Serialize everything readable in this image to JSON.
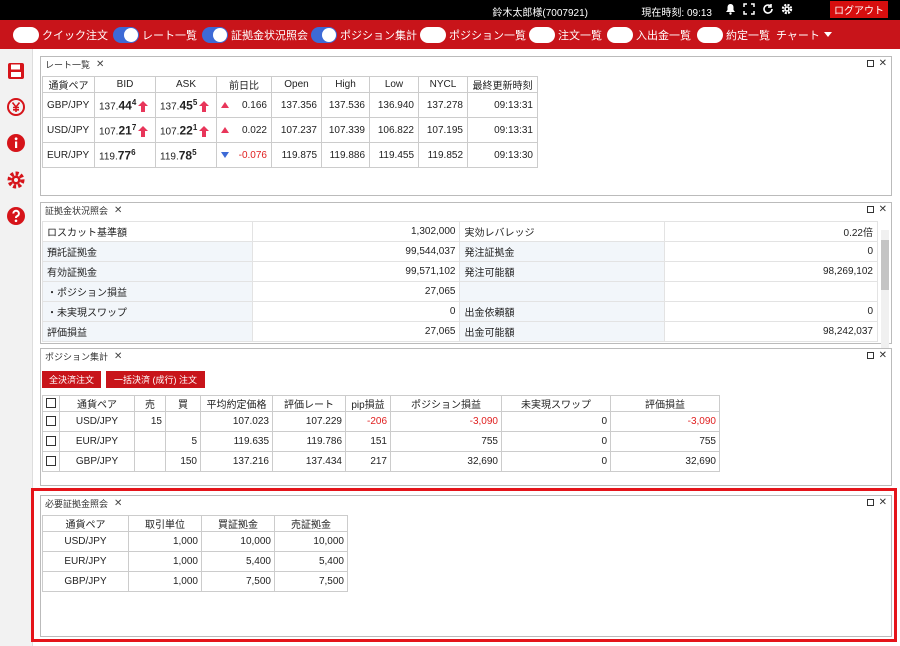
{
  "topbar": {
    "user": "鈴木太郎様(7007921)",
    "time_label": "現在時刻: 09:13",
    "logout_label": "ログアウト",
    "icons": [
      "bell-icon",
      "fullscreen-icon",
      "refresh-icon",
      "gear-icon"
    ]
  },
  "toolbar": {
    "items": [
      {
        "label": "クイック注文",
        "on": false
      },
      {
        "label": "レート一覧",
        "on": true
      },
      {
        "label": "証拠金状況照会",
        "on": true
      },
      {
        "label": "ポジション集計",
        "on": true
      },
      {
        "label": "ポジション一覧",
        "on": false
      },
      {
        "label": "注文一覧",
        "on": false
      },
      {
        "label": "入出金一覧",
        "on": false
      },
      {
        "label": "約定一覧",
        "on": false
      }
    ],
    "chart_label": "チャート"
  },
  "sidebar": {
    "icons": [
      "save-icon",
      "yen-icon",
      "info-icon",
      "gear-icon",
      "help-icon"
    ],
    "colors": {
      "icon": "#d6141a"
    }
  },
  "rates": {
    "title": "レート一覧",
    "headers": [
      "通貨ペア",
      "BID",
      "ASK",
      "前日比",
      "Open",
      "High",
      "Low",
      "NYCL",
      "最終更新時刻"
    ],
    "rows": [
      {
        "pair": "GBP/JPY",
        "bid_pre": "137.",
        "bid_big": "44",
        "bid_sup": "4",
        "ask_pre": "137.",
        "ask_big": "45",
        "ask_sup": "5",
        "arrow": true,
        "dir": "up",
        "change": "0.166",
        "open": "137.356",
        "high": "137.536",
        "low": "136.940",
        "nycl": "137.278",
        "time": "09:13:31"
      },
      {
        "pair": "USD/JPY",
        "bid_pre": "107.",
        "bid_big": "21",
        "bid_sup": "7",
        "ask_pre": "107.",
        "ask_big": "22",
        "ask_sup": "1",
        "arrow": true,
        "dir": "up",
        "change": "0.022",
        "open": "107.237",
        "high": "107.339",
        "low": "106.822",
        "nycl": "107.195",
        "time": "09:13:31"
      },
      {
        "pair": "EUR/JPY",
        "bid_pre": "119.",
        "bid_big": "77",
        "bid_sup": "6",
        "ask_pre": "119.",
        "ask_big": "78",
        "ask_sup": "5",
        "arrow": false,
        "dir": "down",
        "change": "-0.076",
        "open": "119.875",
        "high": "119.886",
        "low": "119.455",
        "nycl": "119.852",
        "time": "09:13:30"
      }
    ]
  },
  "margin": {
    "title": "証拠金状況照会",
    "rows": [
      {
        "l1": "ロスカット基準額",
        "v1": "1,302,000",
        "l2": "実効レバレッジ",
        "v2": "0.22倍"
      },
      {
        "l1": "預託証拠金",
        "v1": "99,544,037",
        "l2": "発注証拠金",
        "v2": "0"
      },
      {
        "l1": "有効証拠金",
        "v1": "99,571,102",
        "l2": "発注可能額",
        "v2": "98,269,102"
      },
      {
        "l1": "・ポジション損益",
        "v1": "27,065",
        "l2": "",
        "v2": ""
      },
      {
        "l1": "・未実現スワップ",
        "v1": "0",
        "l2": "出金依頼額",
        "v2": "0"
      },
      {
        "l1": "評価損益",
        "v1": "27,065",
        "l2": "出金可能額",
        "v2": "98,242,037"
      }
    ]
  },
  "positions": {
    "title": "ポジション集計",
    "btn_settle_all": "全決済注文",
    "btn_bulk": "一括決済 (成行) 注文",
    "headers": [
      "通貨ペア",
      "売",
      "買",
      "平均約定価格",
      "評価レート",
      "pip損益",
      "ポジション損益",
      "未実現スワップ",
      "評価損益"
    ],
    "rows": [
      {
        "pair": "USD/JPY",
        "sell": "15",
        "buy": "",
        "avg": "107.023",
        "rate": "107.229",
        "pip": "-206",
        "pl": "-3,090",
        "swap": "0",
        "eval": "-3,090",
        "neg": true
      },
      {
        "pair": "EUR/JPY",
        "sell": "",
        "buy": "5",
        "avg": "119.635",
        "rate": "119.786",
        "pip": "151",
        "pl": "755",
        "swap": "0",
        "eval": "755",
        "neg": false
      },
      {
        "pair": "GBP/JPY",
        "sell": "",
        "buy": "150",
        "avg": "137.216",
        "rate": "137.434",
        "pip": "217",
        "pl": "32,690",
        "swap": "0",
        "eval": "32,690",
        "neg": false
      }
    ],
    "colors": {
      "negative": "#e02020"
    }
  },
  "required": {
    "title": "必要証拠金照会",
    "headers": [
      "通貨ペア",
      "取引単位",
      "買証拠金",
      "売証拠金"
    ],
    "rows": [
      {
        "pair": "USD/JPY",
        "unit": "1,000",
        "buy": "10,000",
        "sell": "10,000"
      },
      {
        "pair": "EUR/JPY",
        "unit": "1,000",
        "buy": "5,400",
        "sell": "5,400"
      },
      {
        "pair": "GBP/JPY",
        "unit": "1,000",
        "buy": "7,500",
        "sell": "7,500"
      }
    ]
  },
  "colors": {
    "brand": "#c8141a",
    "toggle_on": "#3d6ad6",
    "highlight": "#e5141a"
  }
}
